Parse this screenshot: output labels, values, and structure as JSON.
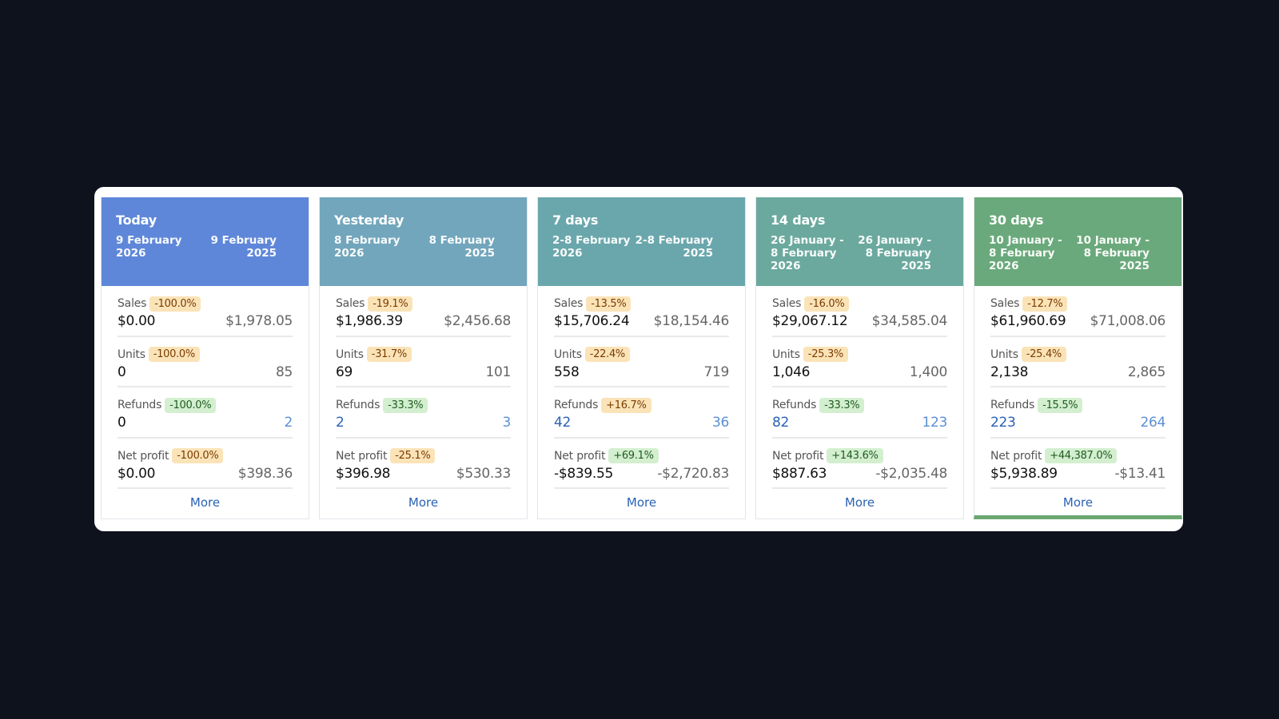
{
  "cards": [
    {
      "period": "Today",
      "date_current": "9 February\n2026",
      "date_previous": "9 February\n2025",
      "header_color": "#5f87d9",
      "sales": {
        "label": "Sales",
        "change": "-100.0%",
        "current": "$0.00",
        "previous": "$1,978.05"
      },
      "units": {
        "label": "Units",
        "change": "-100.0%",
        "current": "0",
        "previous": "85"
      },
      "refunds": {
        "label": "Refunds",
        "change": "-100.0%",
        "current": "0",
        "previous": "2"
      },
      "net_profit": {
        "label": "Net profit",
        "change": "-100.0%",
        "current": "$0.00",
        "previous": "$398.36"
      },
      "more_label": "More"
    },
    {
      "period": "Yesterday",
      "date_current": "8 February\n2026",
      "date_previous": "8 February\n2025",
      "header_color": "#72a6bc",
      "sales": {
        "label": "Sales",
        "change": "-19.1%",
        "current": "$1,986.39",
        "previous": "$2,456.68"
      },
      "units": {
        "label": "Units",
        "change": "-31.7%",
        "current": "69",
        "previous": "101"
      },
      "refunds": {
        "label": "Refunds",
        "change": "-33.3%",
        "current": "2",
        "previous": "3"
      },
      "net_profit": {
        "label": "Net profit",
        "change": "-25.1%",
        "current": "$396.98",
        "previous": "$530.33"
      },
      "more_label": "More"
    },
    {
      "period": "7 days",
      "date_current": "2-8 February\n2026",
      "date_previous": "2-8 February\n2025",
      "header_color": "#6aa7ac",
      "sales": {
        "label": "Sales",
        "change": "-13.5%",
        "current": "$15,706.24",
        "previous": "$18,154.46"
      },
      "units": {
        "label": "Units",
        "change": "-22.4%",
        "current": "558",
        "previous": "719"
      },
      "refunds": {
        "label": "Refunds",
        "change": "+16.7%",
        "current": "42",
        "previous": "36"
      },
      "net_profit": {
        "label": "Net profit",
        "change": "+69.1%",
        "current": "-$839.55",
        "previous": "-$2,720.83"
      },
      "more_label": "More"
    },
    {
      "period": "14 days",
      "date_current": "26 January -\n8 February\n2026",
      "date_previous": "26 January -\n8 February\n2025",
      "header_color": "#6ba99e",
      "sales": {
        "label": "Sales",
        "change": "-16.0%",
        "current": "$29,067.12",
        "previous": "$34,585.04"
      },
      "units": {
        "label": "Units",
        "change": "-25.3%",
        "current": "1,046",
        "previous": "1,400"
      },
      "refunds": {
        "label": "Refunds",
        "change": "-33.3%",
        "current": "82",
        "previous": "123"
      },
      "net_profit": {
        "label": "Net profit",
        "change": "+143.6%",
        "current": "$887.63",
        "previous": "-$2,035.48"
      },
      "more_label": "More"
    },
    {
      "period": "30 days",
      "date_current": "10 January -\n8 February\n2026",
      "date_previous": "10 January -\n8 February\n2025",
      "header_color": "#6aa97b",
      "sales": {
        "label": "Sales",
        "change": "-12.7%",
        "current": "$61,960.69",
        "previous": "$71,008.06"
      },
      "units": {
        "label": "Units",
        "change": "-25.4%",
        "current": "2,138",
        "previous": "2,865"
      },
      "refunds": {
        "label": "Refunds",
        "change": "-15.5%",
        "current": "223",
        "previous": "264"
      },
      "net_profit": {
        "label": "Net profit",
        "change": "+44,387.0%",
        "current": "$5,938.89",
        "previous": "-$13.41"
      },
      "more_label": "More"
    }
  ],
  "badge_colors": {
    "negative_bg": "#fbe3b8",
    "positive_bg": "#d3efcf"
  },
  "active_card_accent": "#69a76f"
}
